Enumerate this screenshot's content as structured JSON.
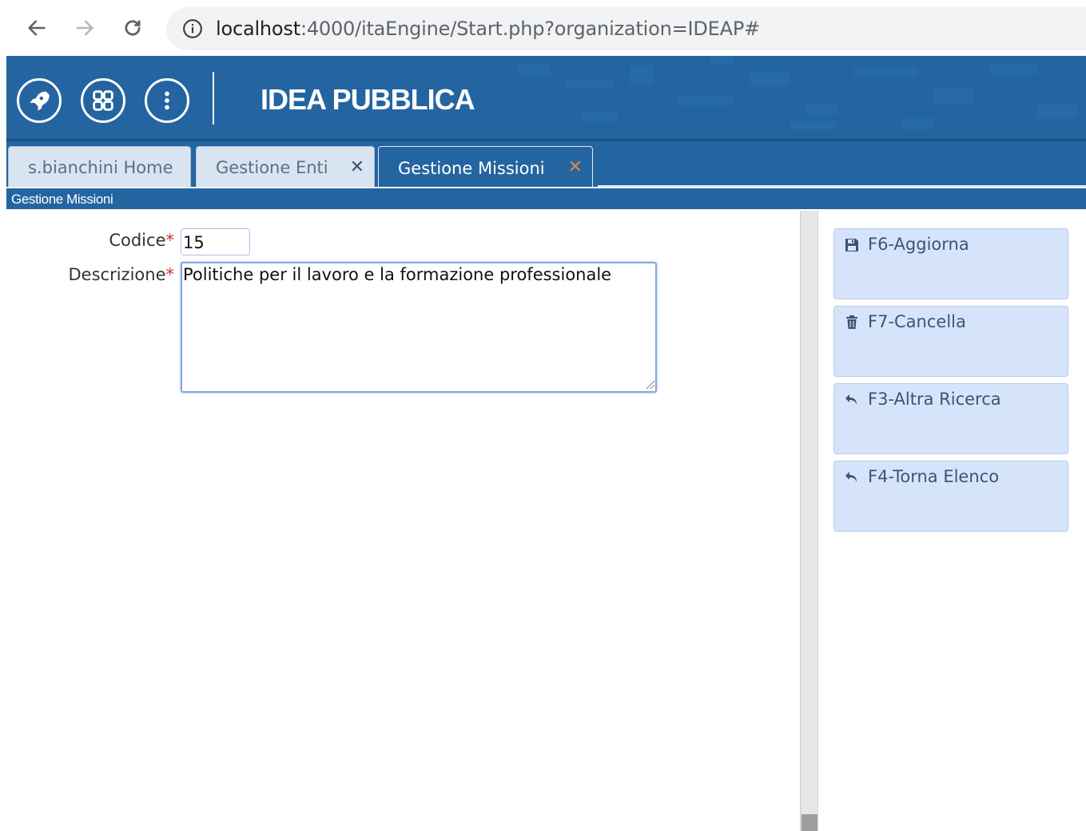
{
  "browser": {
    "url_host": "localhost",
    "url_path": ":4000/itaEngine/Start.php?organization=IDEAP#"
  },
  "header": {
    "title": "IDEA PUBBLICA",
    "icons": [
      "rocket-icon",
      "apps-grid-icon",
      "more-vertical-icon"
    ]
  },
  "tabs": [
    {
      "label": "s.bianchini Home",
      "closable": false,
      "active": false
    },
    {
      "label": "Gestione Enti",
      "closable": true,
      "active": false
    },
    {
      "label": "Gestione Missioni",
      "closable": true,
      "active": true
    }
  ],
  "tab_close_glyph": "✕",
  "breadcrumb": "Gestione Missioni",
  "form": {
    "codice_label": "Codice",
    "codice_value": "15",
    "descrizione_label": "Descrizione",
    "descrizione_value": "Politiche per il lavoro e la formazione professionale",
    "required_mark": "*"
  },
  "actions": [
    {
      "label": "F6-Aggiorna",
      "icon": "save-icon"
    },
    {
      "label": "F7-Cancella",
      "icon": "trash-icon"
    },
    {
      "label": "F3-Altra Ricerca",
      "icon": "undo-arrow-icon"
    },
    {
      "label": "F4-Torna Elenco",
      "icon": "undo-arrow-icon"
    }
  ],
  "colors": {
    "header_blue": "#2465a1",
    "button_bg": "#d6e4fb",
    "active_close": "#e8853a",
    "required": "#d9302c"
  }
}
